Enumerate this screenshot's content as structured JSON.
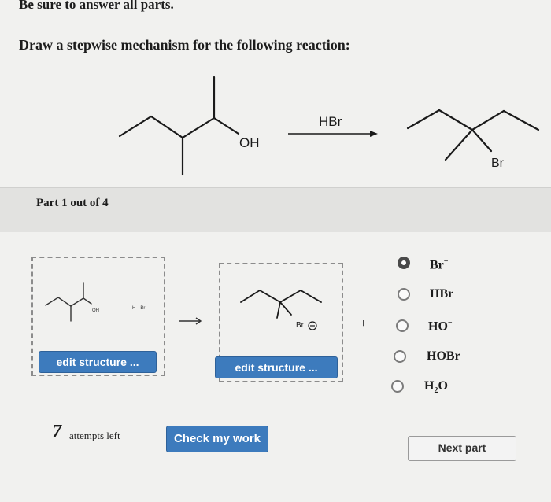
{
  "instructions": "Be sure to answer all parts.",
  "prompt": "Draw a stepwise mechanism for the following reaction:",
  "reaction": {
    "reactant_label": "OH",
    "reagent": "HBr",
    "product_label": "Br"
  },
  "part": {
    "label": "Part 1 out of 4"
  },
  "step": {
    "box1_oh": "OH",
    "box1_hbr": "H—Br",
    "box2_br": "Br",
    "edit_label": "edit structure ...",
    "plus": "+",
    "arrow": "→"
  },
  "options": [
    {
      "base": "Br",
      "sup": "−",
      "sub": "",
      "tail": "",
      "selected": true
    },
    {
      "base": "HBr",
      "sup": "",
      "sub": "",
      "tail": "",
      "selected": false
    },
    {
      "base": "HO",
      "sup": "−",
      "sub": "",
      "tail": "",
      "selected": false
    },
    {
      "base": "HOBr",
      "sup": "",
      "sub": "",
      "tail": "",
      "selected": false
    },
    {
      "base": "H",
      "sup": "",
      "sub": "2",
      "tail": "O",
      "selected": false
    }
  ],
  "attempts": {
    "count": "7",
    "text": "attempts left"
  },
  "buttons": {
    "check": "Check my work",
    "next": "Next part"
  }
}
